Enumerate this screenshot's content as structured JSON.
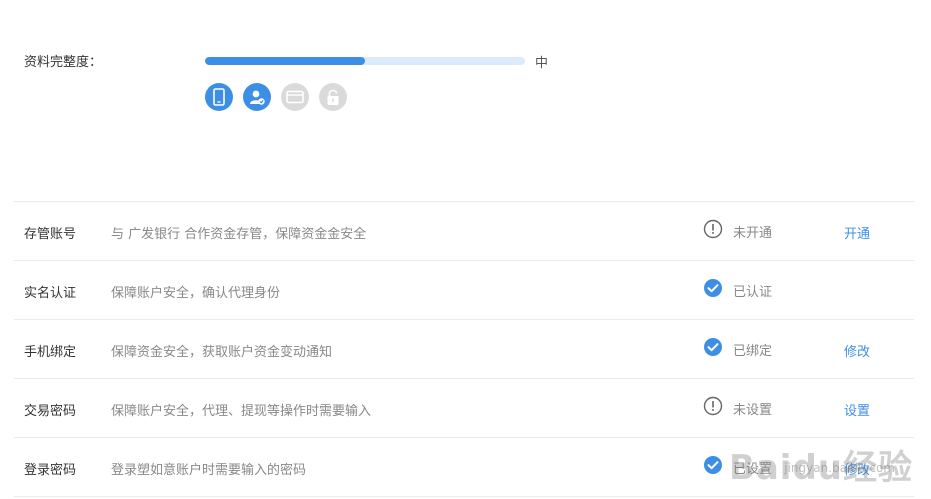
{
  "profile": {
    "completeness_label": "资料完整度：",
    "progress_fraction": 0.5,
    "level_text": "中",
    "icons": [
      {
        "name": "phone-icon",
        "state": "active"
      },
      {
        "name": "verified-user-icon",
        "state": "active"
      },
      {
        "name": "wallet-card-icon",
        "state": "inactive"
      },
      {
        "name": "lock-icon",
        "state": "inactive"
      }
    ]
  },
  "rows": [
    {
      "title": "存管账号",
      "desc": "与 广发银行 合作资金存管，保障资金金安全",
      "status": "未开通",
      "status_type": "warning",
      "action": "开通"
    },
    {
      "title": "实名认证",
      "desc": "保障账户安全，确认代理身份",
      "status": "已认证",
      "status_type": "ok",
      "action": ""
    },
    {
      "title": "手机绑定",
      "desc": "保障资金安全，获取账户资金变动通知",
      "status": "已绑定",
      "status_type": "ok",
      "action": "修改"
    },
    {
      "title": "交易密码",
      "desc": "保障账户安全，代理、提现等操作时需要输入",
      "status": "未设置",
      "status_type": "warning",
      "action": "设置"
    },
    {
      "title": "登录密码",
      "desc": "登录塑如意账户时需要输入的密码",
      "status": "已设置",
      "status_type": "ok",
      "action": "修改"
    }
  ],
  "watermark": {
    "logo": "Baidu经验",
    "url": "jingyan.baidu.com"
  },
  "colors": {
    "accent": "#3d8fe6",
    "track": "#dcebfb",
    "inactive_icon": "#dadada"
  }
}
